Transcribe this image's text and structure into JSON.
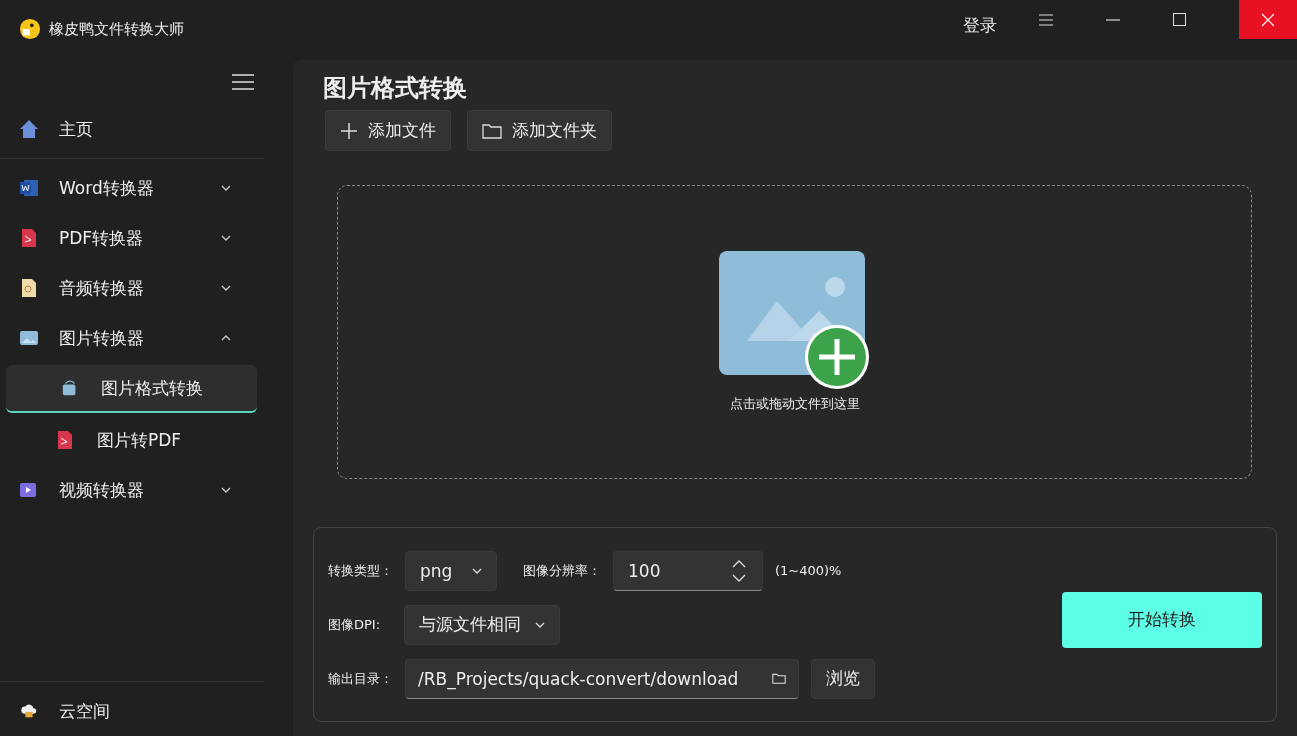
{
  "app": {
    "title": "橡皮鸭文件转换大师",
    "login": "登录"
  },
  "sidebar": {
    "items": [
      {
        "label": "主页",
        "kind": "link",
        "selected": false
      },
      {
        "label": "Word转换器",
        "kind": "group",
        "selected": false,
        "expanded": false
      },
      {
        "label": "PDF转换器",
        "kind": "group",
        "selected": false,
        "expanded": false
      },
      {
        "label": "音频转换器",
        "kind": "group",
        "selected": false,
        "expanded": false
      },
      {
        "label": "图片转换器",
        "kind": "group",
        "selected": false,
        "expanded": true,
        "children": [
          {
            "label": "图片格式转换",
            "selected": true
          },
          {
            "label": "图片转PDF",
            "selected": false
          }
        ]
      },
      {
        "label": "视频转换器",
        "kind": "group",
        "selected": false,
        "expanded": false
      }
    ],
    "footer": {
      "label": "云空间"
    }
  },
  "page": {
    "title": "图片格式转换",
    "toolbar": [
      {
        "label": "添加文件"
      },
      {
        "label": "添加文件夹"
      }
    ],
    "dropzone": {
      "hint": "点击或拖动文件到这里"
    }
  },
  "settings": {
    "format": {
      "label": "转换类型：",
      "value": "png"
    },
    "resolution": {
      "label": "图像分辨率：",
      "value": "100",
      "range": "(1~400)%"
    },
    "dpi": {
      "label": "图像DPI:",
      "value": "与源文件相同"
    },
    "output": {
      "label": "输出目录：",
      "value": "/RB_Projects/quack-convert/download",
      "browse": "浏览"
    },
    "start": "开始转换"
  }
}
